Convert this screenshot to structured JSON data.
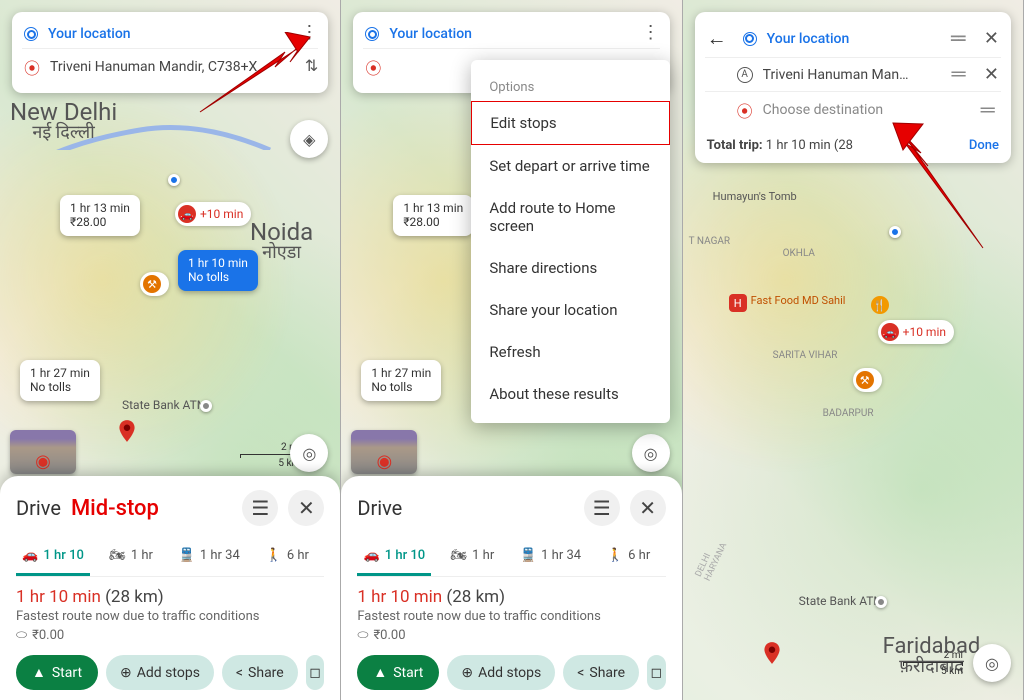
{
  "panel1": {
    "origin": "Your location",
    "destination": "Triveni Hanuman Mandir, C738+X",
    "callout_alt1_time": "1 hr 13 min",
    "callout_alt1_cost": "₹28.00",
    "callout_alt2_time": "1 hr 27 min",
    "callout_alt2_sub": "No tolls",
    "callout_main_time": "1 hr 10 min",
    "callout_main_sub": "No tolls",
    "traffic_delay": "+10 min",
    "city_main": "Noida",
    "city_native": "नोएडा",
    "city_nw": "New Delhi",
    "city_nw_native": "नई दिल्ली",
    "poi_bank": "State Bank ATM",
    "scale_top": "2 mi",
    "scale_bottom": "5 km",
    "sheet_title": "Drive",
    "annotation": "Mid-stop",
    "mode_car": "1 hr 10",
    "mode_bike": "1 hr",
    "mode_transit": "1 hr 34",
    "mode_walk": "6 hr",
    "summary_time": "1 hr 10 min",
    "summary_dist": "(28 km)",
    "summary_sub": "Fastest route now due to traffic conditions",
    "summary_cost": "₹0.00",
    "btn_start": "Start",
    "btn_addstops": "Add stops",
    "btn_share": "Share"
  },
  "panel2": {
    "origin": "Your location",
    "menu": {
      "header": "Options",
      "items": [
        "Edit stops",
        "Set depart or arrive time",
        "Add route to Home screen",
        "Share directions",
        "Share your location",
        "Refresh",
        "About these results"
      ]
    },
    "callout_alt1_time": "1 hr 13 min",
    "callout_alt1_cost": "₹28.00",
    "callout_alt2_time": "1 hr 27 min",
    "callout_alt2_sub": "No tolls",
    "sheet_title": "Drive",
    "mode_car": "1 hr 10",
    "mode_bike": "1 hr",
    "mode_transit": "1 hr 34",
    "mode_walk": "6 hr",
    "summary_time": "1 hr 10 min",
    "summary_dist": "(28 km)",
    "summary_sub": "Fastest route now due to traffic conditions",
    "summary_cost": "₹0.00",
    "btn_start": "Start",
    "btn_addstops": "Add stops",
    "btn_share": "Share"
  },
  "panel3": {
    "origin": "Your location",
    "stop_a": "Triveni Hanuman Man…",
    "choose_dest": "Choose destination",
    "total_label": "Total trip:",
    "total_value": "1 hr 10 min (28",
    "done": "Done",
    "traffic_delay": "+10 min",
    "poi_fastfood": "Fast Food MD Sahil",
    "poi_tomb": "Humayun's Tomb",
    "poi_bank": "State Bank ATM",
    "area_okhla": "OKHLA",
    "area_vihar": "SARITA VIHAR",
    "area_badarpur": "BADARPUR",
    "area_nagar": "T NAGAR",
    "city_f": "Faridabad",
    "city_f_native": "फ़रीदाबाद",
    "border": "DELHI\nHARYANA",
    "scale_top": "2 mi",
    "scale_bottom": "5 km"
  }
}
